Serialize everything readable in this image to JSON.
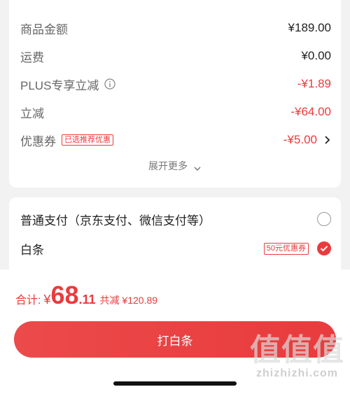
{
  "summary": {
    "rows": [
      {
        "label": "商品金额",
        "amount": "¥189.00"
      },
      {
        "label": "运费",
        "amount": "¥0.00"
      },
      {
        "label": "PLUS专享立减",
        "amount": "-¥1.89",
        "icon": "info-icon"
      },
      {
        "label": "立减",
        "amount": "-¥64.00"
      },
      {
        "label": "优惠券",
        "amount": "-¥5.00",
        "badge": "已选推荐优惠",
        "icon": "chevron-right-icon"
      }
    ],
    "expand_label": "展开更多"
  },
  "payment": {
    "options": [
      {
        "label": "普通支付（京东支付、微信支付等）",
        "selected": false
      },
      {
        "label": "白条",
        "tag": "50元优惠券",
        "selected": true
      }
    ]
  },
  "footer": {
    "total_label": "合计:",
    "currency": "¥",
    "total_int": "68",
    "total_dec": ".11",
    "saving": "共减 ¥120.89",
    "button_label": "打白条"
  },
  "watermark": {
    "main": "值值值",
    "sub": "zhizhizhi.com"
  },
  "colors": {
    "accent": "#e93b3d",
    "background": "#f2f2f2"
  }
}
